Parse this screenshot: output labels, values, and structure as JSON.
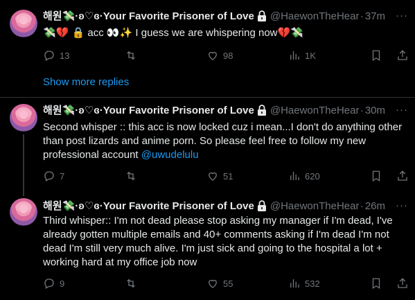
{
  "tweets": [
    {
      "name": "해원💸·ʚ♡ɞ·Your Favorite Prisoner of Love",
      "handle": "@HaewonTheHeart",
      "time": "37m",
      "text": "💸💔 🔒 acc 👀✨ I guess we are whispering now💔💸",
      "reply_count": "13",
      "retweet_count": "",
      "like_count": "98",
      "view_count": "1K"
    },
    {
      "name": "해원💸·ʚ♡ɞ·Your Favorite Prisoner of Love",
      "handle": "@HaewonTheHeart",
      "time": "30m",
      "text": "Second whisper :: this acc is now locked cuz i mean...I don't do anything other than post lizards and anime porn. So please feel free to follow my new professional account ",
      "mention": "@uwudelulu",
      "reply_count": "7",
      "retweet_count": "",
      "like_count": "51",
      "view_count": "620"
    },
    {
      "name": "해원💸·ʚ♡ɞ·Your Favorite Prisoner of Love",
      "handle": "@HaewonTheHeart",
      "time": "26m",
      "text": "Third whisper:: I'm not dead please stop asking my manager if I'm dead, I've already gotten multiple emails and 40+ comments asking if I'm dead I'm not dead I'm still very much alive. I'm just sick and going to the hospital a lot + working hard at my office job now",
      "reply_count": "9",
      "retweet_count": "",
      "like_count": "55",
      "view_count": "532"
    }
  ],
  "show_more_label": "Show more replies",
  "more_glyph": "···",
  "dot_separator": "·",
  "colors": {
    "accent": "#1d9bf0",
    "muted": "#71767b",
    "background": "#000000"
  },
  "icons": [
    "lock-icon",
    "reply-icon",
    "retweet-icon",
    "like-icon",
    "views-icon",
    "bookmark-icon",
    "share-icon",
    "more-icon"
  ]
}
